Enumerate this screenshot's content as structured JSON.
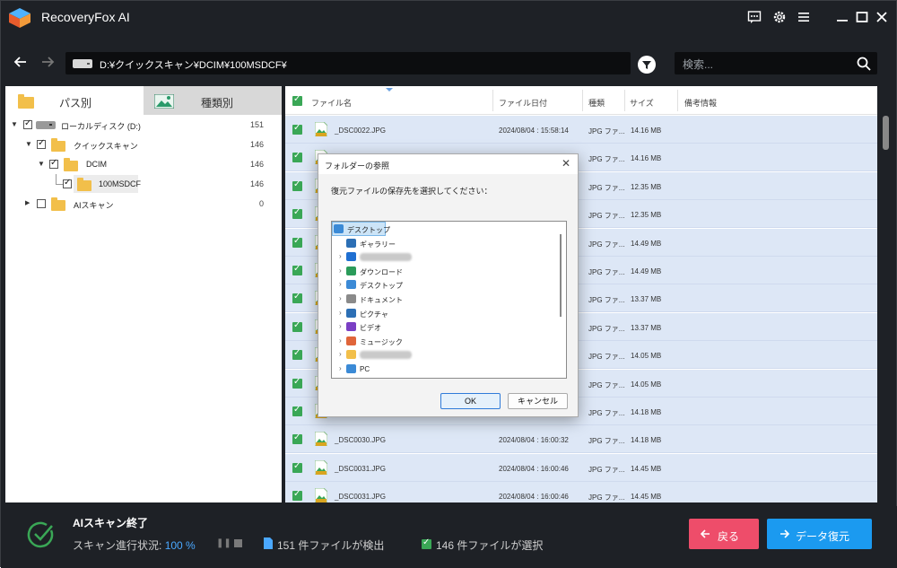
{
  "app": {
    "title": "RecoveryFox AI"
  },
  "nav": {
    "path": "D:¥クイックスキャン¥DCIM¥100MSDCF¥"
  },
  "search": {
    "placeholder": "検索..."
  },
  "left_tabs": {
    "path_tab": "パス別",
    "type_tab": "種類別"
  },
  "tree": [
    {
      "label": "ローカルディスク (D:)",
      "count": "151"
    },
    {
      "label": "クイックスキャン",
      "count": "146"
    },
    {
      "label": "DCIM",
      "count": "146"
    },
    {
      "label": "100MSDCF",
      "count": "146"
    },
    {
      "label": "AIスキャン",
      "count": "0"
    }
  ],
  "columns": {
    "name": "ファイル名",
    "date": "ファイル日付",
    "type": "種類",
    "size": "サイズ",
    "note": "備考情報"
  },
  "files": [
    {
      "name": "_DSC0022.JPG",
      "date": "2024/08/04 : 15:58:14",
      "type": "JPG ファ...",
      "size": "14.16 MB"
    },
    {
      "name": "",
      "date": "",
      "type": "JPG ファ...",
      "size": "14.16 MB"
    },
    {
      "name": "",
      "date": "",
      "type": "JPG ファ...",
      "size": "12.35 MB"
    },
    {
      "name": "",
      "date": "",
      "type": "JPG ファ...",
      "size": "12.35 MB"
    },
    {
      "name": "",
      "date": "",
      "type": "JPG ファ...",
      "size": "14.49 MB"
    },
    {
      "name": "",
      "date": "",
      "type": "JPG ファ...",
      "size": "14.49 MB"
    },
    {
      "name": "",
      "date": "",
      "type": "JPG ファ...",
      "size": "13.37 MB"
    },
    {
      "name": "",
      "date": "",
      "type": "JPG ファ...",
      "size": "13.37 MB"
    },
    {
      "name": "",
      "date": "",
      "type": "JPG ファ...",
      "size": "14.05 MB"
    },
    {
      "name": "",
      "date": "",
      "type": "JPG ファ...",
      "size": "14.05 MB"
    },
    {
      "name": "",
      "date": "",
      "type": "JPG ファ...",
      "size": "14.18 MB"
    },
    {
      "name": "_DSC0030.JPG",
      "date": "2024/08/04 : 16:00:32",
      "type": "JPG ファ...",
      "size": "14.18 MB"
    },
    {
      "name": "_DSC0031.JPG",
      "date": "2024/08/04 : 16:00:46",
      "type": "JPG ファ...",
      "size": "14.45 MB"
    },
    {
      "name": "_DSC0031.JPG",
      "date": "2024/08/04 : 16:00:46",
      "type": "JPG ファ...",
      "size": "14.45 MB"
    }
  ],
  "dialog": {
    "title": "フォルダーの参照",
    "prompt": "復元ファイルの保存先を選択してください：",
    "items": [
      {
        "label": "デスクトップ",
        "icon": "desktop-icon",
        "color": "#3b8ad6"
      },
      {
        "label": "ギャラリー",
        "icon": "gallery-icon",
        "color": "#2c6fb5"
      },
      {
        "label": "",
        "icon": "onedrive-icon",
        "color": "#1f6fd1"
      },
      {
        "label": "ダウンロード",
        "icon": "download-icon",
        "color": "#2b9b5a"
      },
      {
        "label": "デスクトップ",
        "icon": "desktop-icon",
        "color": "#3b8ad6"
      },
      {
        "label": "ドキュメント",
        "icon": "document-icon",
        "color": "#8a8a8a"
      },
      {
        "label": "ピクチャ",
        "icon": "pictures-icon",
        "color": "#2c6fb5"
      },
      {
        "label": "ビデオ",
        "icon": "video-icon",
        "color": "#7a3fc4"
      },
      {
        "label": "ミュージック",
        "icon": "music-icon",
        "color": "#e0653a"
      },
      {
        "label": "",
        "icon": "folder-icon",
        "color": "#f2bf4a"
      },
      {
        "label": "PC",
        "icon": "pc-icon",
        "color": "#3b8ad6"
      }
    ],
    "ok": "OK",
    "cancel": "キャンセル"
  },
  "bottom": {
    "title": "AIスキャン終了",
    "progress_label": "スキャン進行状況:",
    "progress_value": "100 %",
    "found": "151 件ファイルが検出",
    "selected": "146 件ファイルが選択",
    "back": "戻る",
    "recover": "データ復元"
  },
  "colors": {
    "accent": "#1b9af0",
    "back": "#ee4d6a",
    "check": "#3aa756",
    "row_bg": "#dde7f6"
  }
}
